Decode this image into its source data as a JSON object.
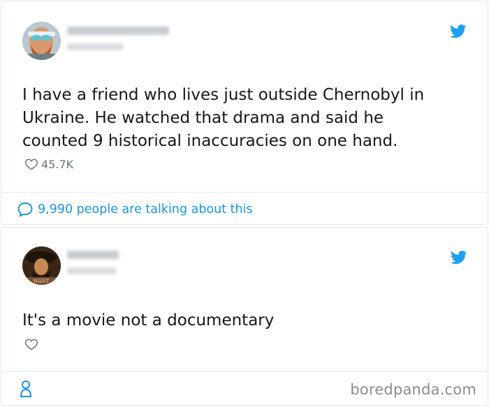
{
  "tweet1": {
    "text_lines": [
      "I have a friend who lives just outside Chernobyl in",
      "Ukraine. He watched that drama and said he",
      "counted 9 historical inaccuracies on one hand."
    ],
    "likes": "45.7K",
    "talking": "9,990 people are talking about this"
  },
  "tweet2": {
    "text": "It's a movie not a documentary"
  },
  "footer": {
    "watermark": "boredpanda.com"
  },
  "colors": {
    "twitter_blue": "#1da1f2",
    "link_blue": "#1b95e0",
    "text": "#14171a",
    "muted": "#657786"
  },
  "icons": [
    "twitter-bird-icon",
    "heart-icon",
    "speech-bubble-icon",
    "person-icon"
  ]
}
